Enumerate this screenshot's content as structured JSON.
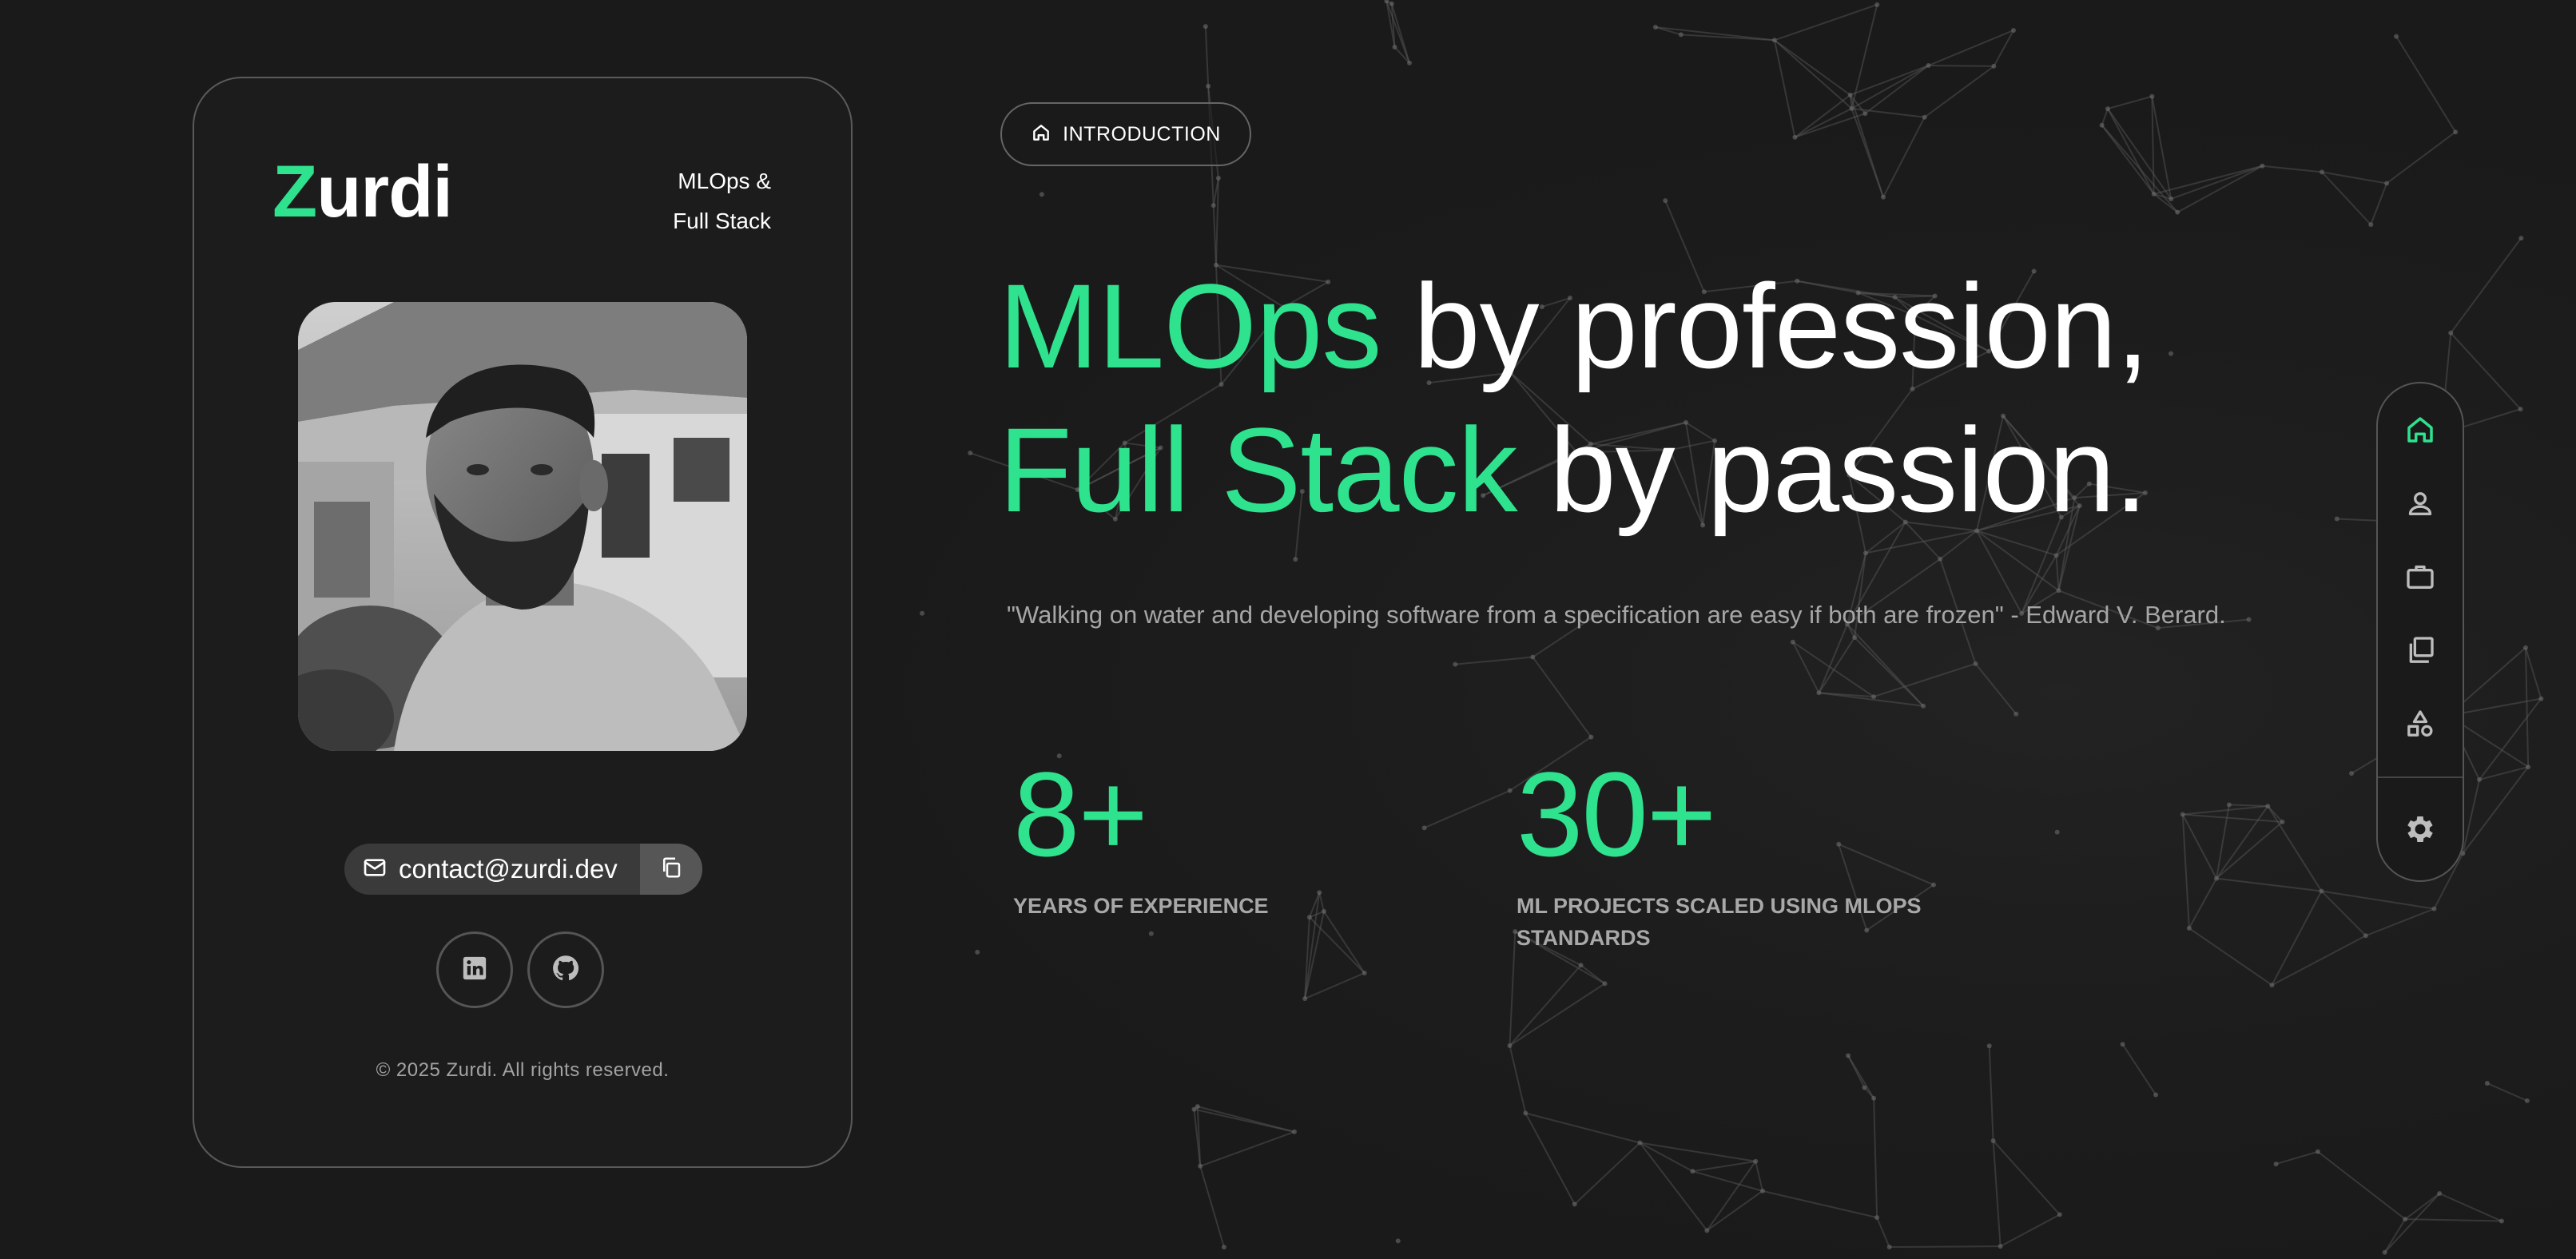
{
  "profile": {
    "brand_initial": "Z",
    "brand_rest": "urdi",
    "role_line1": "MLOps &",
    "role_line2": "Full Stack",
    "email": "contact@zurdi.dev",
    "copyright": "© 2025 Zurdi. All rights reserved.",
    "social_icons": [
      "linkedin-icon",
      "github-icon"
    ]
  },
  "intro": {
    "badge_label": "INTRODUCTION",
    "headline": {
      "line1_accent": "MLOps",
      "line1_rest": " by profession,",
      "line2_accent": "Full Stack",
      "line2_rest": " by passion."
    },
    "quote": "\"Walking on water and developing software from a specification are easy if both are frozen\" - Edward V. Berard.",
    "stats": [
      {
        "value": "8+",
        "label": "YEARS OF EXPERIENCE"
      },
      {
        "value": "30+",
        "label": "ML PROJECTS SCALED USING MLOPS STANDARDS"
      }
    ]
  },
  "nav": {
    "items": [
      "home-icon",
      "user-icon",
      "briefcase-icon",
      "layers-icon",
      "shapes-icon",
      "gear-icon"
    ],
    "active": "home-icon"
  },
  "colors": {
    "accent": "#2ee28e",
    "background": "#1a1a1a",
    "muted_text": "#a6a6a6",
    "border": "#555555"
  }
}
